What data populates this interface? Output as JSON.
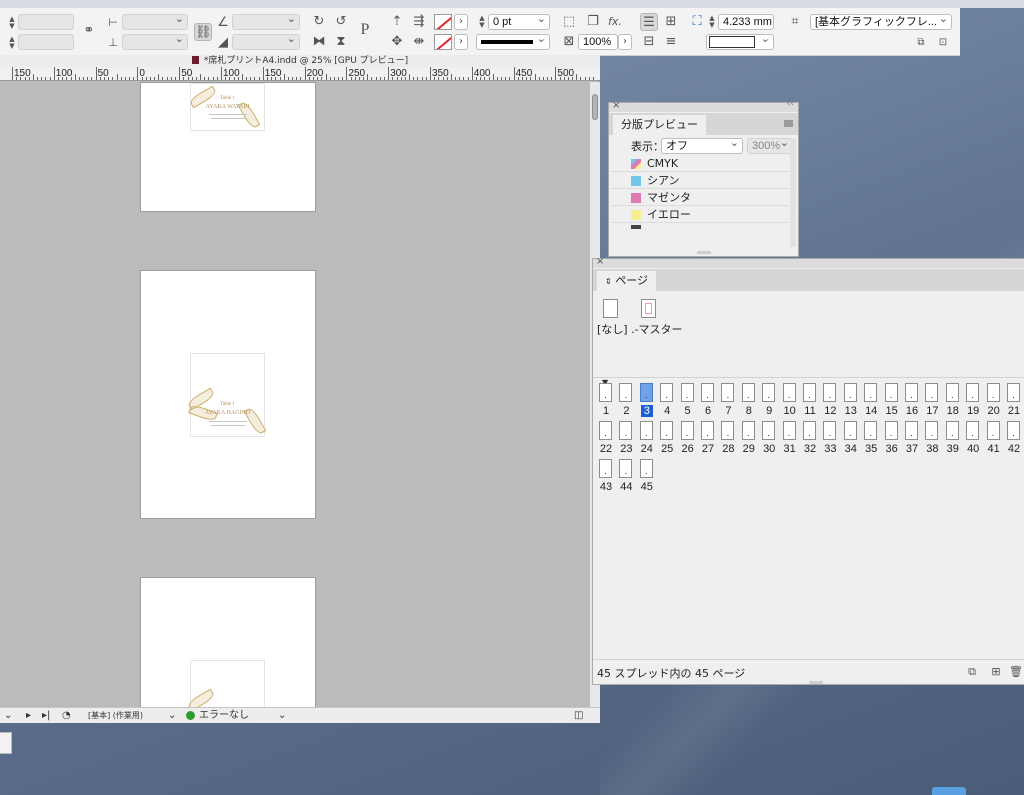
{
  "control_panel": {
    "stroke_weight": "0 pt",
    "zoom_percent": "100%",
    "dimension": "4.233 mm",
    "object_style": "[基本グラフィックフレ..."
  },
  "document": {
    "title": "*席札プリントA4.indd @ 25% [GPU プレビュー]",
    "ruler_labels": [
      "150",
      "100",
      "50",
      "0",
      "50",
      "100",
      "150",
      "200",
      "250",
      "300",
      "350",
      "400",
      "450",
      "500"
    ],
    "card_title": "Table 1",
    "card_name_1": "AYAKA WATARI",
    "card_name_2": "AYAKA HAGINO",
    "status_profile": "[基本] (作業用)",
    "status_errors": "エラーなし"
  },
  "separations_panel": {
    "title": "分版プレビュー",
    "view_label": "表示：",
    "view_value": "オフ",
    "zoom_value": "300%",
    "inks": [
      {
        "name": "CMYK",
        "color": "multi"
      },
      {
        "name": "シアン",
        "color": "#6ec6e8"
      },
      {
        "name": "マゼンタ",
        "color": "#e07ab3"
      },
      {
        "name": "イエロー",
        "color": "#f7ef8f"
      }
    ]
  },
  "pages_panel": {
    "title": "ページ",
    "master_label": "[なし] .-マスター",
    "selected_page": "3",
    "pages": [
      "1",
      "2",
      "3",
      "4",
      "5",
      "6",
      "7",
      "8",
      "9",
      "10",
      "11",
      "12",
      "13",
      "14",
      "15",
      "16",
      "17",
      "18",
      "19",
      "20",
      "21",
      "22",
      "23",
      "24",
      "25",
      "26",
      "27",
      "28",
      "29",
      "30",
      "31",
      "32",
      "33",
      "34",
      "35",
      "36",
      "37",
      "38",
      "39",
      "40",
      "41",
      "42",
      "43",
      "44",
      "45"
    ],
    "footer_text": "45 スプレッド内の 45 ページ"
  }
}
